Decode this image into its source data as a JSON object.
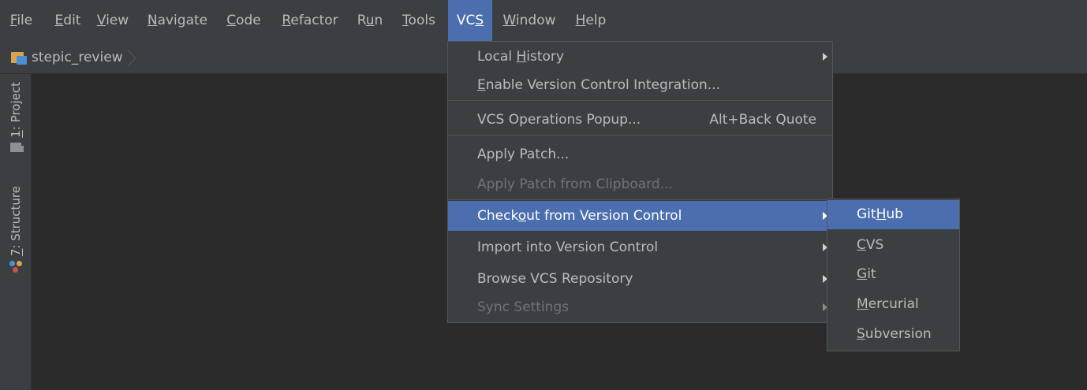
{
  "menubar": {
    "items": [
      {
        "pre": "",
        "m": "F",
        "post": "ile"
      },
      {
        "pre": "",
        "m": "E",
        "post": "dit"
      },
      {
        "pre": "",
        "m": "V",
        "post": "iew"
      },
      {
        "pre": "",
        "m": "N",
        "post": "avigate"
      },
      {
        "pre": "",
        "m": "C",
        "post": "ode"
      },
      {
        "pre": "",
        "m": "R",
        "post": "efactor"
      },
      {
        "pre": "R",
        "m": "u",
        "post": "n"
      },
      {
        "pre": "",
        "m": "T",
        "post": "ools"
      },
      {
        "pre": "VC",
        "m": "S",
        "post": ""
      },
      {
        "pre": "",
        "m": "W",
        "post": "indow"
      },
      {
        "pre": "",
        "m": "H",
        "post": "elp"
      }
    ]
  },
  "navbar": {
    "project_name": "stepic_review"
  },
  "sidebar": {
    "project_tab": {
      "num": "1",
      "rest": ": Project"
    },
    "structure_tab": {
      "num": "7",
      "rest": ": Structure"
    }
  },
  "vcs_menu": {
    "items": [
      {
        "pre": "Local ",
        "m": "H",
        "post": "istory"
      },
      {
        "pre": "",
        "m": "E",
        "post": "nable Version Control Integration..."
      },
      {
        "pre": "VCS Operations Popup...",
        "m": "",
        "post": "",
        "shortcut": "Alt+Back Quote"
      },
      {
        "pre": "Apply Patch...",
        "m": "",
        "post": ""
      },
      {
        "pre": "Apply Patch from Clipboard...",
        "m": "",
        "post": ""
      },
      {
        "pre": "Check",
        "m": "o",
        "post": "ut from Version Control"
      },
      {
        "pre": "Import into Version Control",
        "m": "",
        "post": ""
      },
      {
        "pre": "Browse VCS Repository",
        "m": "",
        "post": ""
      },
      {
        "pre": "Sync Settings",
        "m": "",
        "post": ""
      }
    ]
  },
  "checkout_submenu": {
    "items": [
      {
        "pre": "Git",
        "m": "H",
        "post": "ub"
      },
      {
        "pre": "",
        "m": "C",
        "post": "VS"
      },
      {
        "pre": "",
        "m": "G",
        "post": "it"
      },
      {
        "pre": "",
        "m": "M",
        "post": "ercurial"
      },
      {
        "pre": "",
        "m": "S",
        "post": "ubversion"
      }
    ]
  },
  "colors": {
    "background": "#2b2b2b",
    "chrome": "#3c3f41",
    "selection": "#4b6eaf",
    "text": "#bbbbbb",
    "disabled_text": "#6f737a"
  }
}
